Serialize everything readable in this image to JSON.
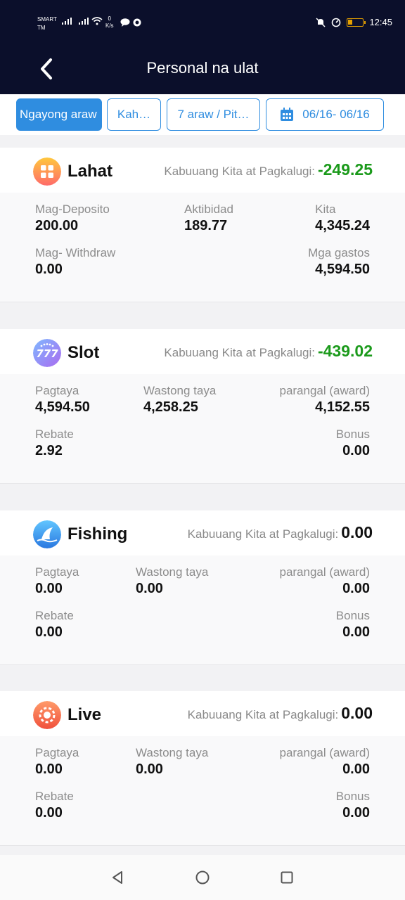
{
  "status": {
    "carrier_line1": "SMART",
    "carrier_line2": "TM",
    "speed_value": "0",
    "speed_unit": "K/s",
    "time": "12:45"
  },
  "header": {
    "title": "Personal na ulat"
  },
  "filters": [
    {
      "label": "Ngayong araw",
      "active": true
    },
    {
      "label": "Kah…"
    },
    {
      "label": "7 araw / Pit…"
    },
    {
      "label": "06/16- 06/16",
      "icon": "calendar-icon"
    }
  ],
  "sections": {
    "lahat": {
      "name": "Lahat",
      "icon": "grid-icon",
      "total_label": "Kabuuang Kita at Pagkalugi:",
      "total_value": "-249.25",
      "deposit_label": "Mag-Deposito",
      "deposit_value": "200.00",
      "activity_label": "Aktibidad",
      "activity_value": "189.77",
      "income_label": "Kita",
      "income_value": "4,345.24",
      "withdraw_label": "Mag- Withdraw",
      "withdraw_value": "0.00",
      "expense_label": "Mga gastos",
      "expense_value": "4,594.50"
    },
    "slot": {
      "name": "Slot",
      "icon": "slot-777-icon",
      "total_label": "Kabuuang Kita at Pagkalugi:",
      "total_value": "-439.02",
      "bet_label": "Pagtaya",
      "bet_value": "4,594.50",
      "valid_label": "Wastong taya",
      "valid_value": "4,258.25",
      "award_label": "parangal (award)",
      "award_value": "4,152.55",
      "rebate_label": "Rebate",
      "rebate_value": "2.92",
      "bonus_label": "Bonus",
      "bonus_value": "0.00"
    },
    "fishing": {
      "name": "Fishing",
      "icon": "shark-fin-icon",
      "total_label": "Kabuuang Kita at Pagkalugi:",
      "total_value": "0.00",
      "bet_label": "Pagtaya",
      "bet_value": "0.00",
      "valid_label": "Wastong taya",
      "valid_value": "0.00",
      "award_label": "parangal (award)",
      "award_value": "0.00",
      "rebate_label": "Rebate",
      "rebate_value": "0.00",
      "bonus_label": "Bonus",
      "bonus_value": "0.00"
    },
    "live": {
      "name": "Live",
      "icon": "poker-chip-icon",
      "total_label": "Kabuuang Kita at Pagkalugi:",
      "total_value": "0.00",
      "bet_label": "Pagtaya",
      "bet_value": "0.00",
      "valid_label": "Wastong taya",
      "valid_value": "0.00",
      "award_label": "parangal (award)",
      "award_value": "0.00",
      "rebate_label": "Rebate",
      "rebate_value": "0.00",
      "bonus_label": "Bonus",
      "bonus_value": "0.00"
    }
  },
  "colors": {
    "header_bg": "#0b0f2b",
    "accent": "#2f8de0",
    "negative": "#1b9a1b"
  }
}
